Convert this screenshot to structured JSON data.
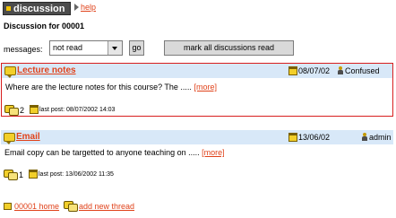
{
  "header": {
    "tab_label": "discussion",
    "help_label": "help"
  },
  "page_title": "Discussion for 00001",
  "filter": {
    "label": "messages:",
    "selected": "not read",
    "go_label": "go",
    "mark_all_label": "mark all discussions read"
  },
  "threads": [
    {
      "title": "Lecture notes",
      "date": "08/07/02",
      "user": "Confused",
      "excerpt": "Where are the lecture notes for this course? The .....",
      "more_label": "[more]",
      "count": "2",
      "last_post": "last post: 08/07/2002 14:03"
    },
    {
      "title": "Email",
      "date": "13/06/02",
      "user": "admin",
      "excerpt": "Email copy can be targetted to anyone teaching on .....",
      "more_label": "[more]",
      "count": "1",
      "last_post": "last post: 13/06/2002 11:35"
    }
  ],
  "footer": {
    "home_label": "00001 home",
    "new_thread_label": "add new thread"
  },
  "colors": {
    "accent": "#e0421a",
    "thread_head_bg": "#d8e8f8",
    "active_border": "#d81e1e"
  },
  "icons": [
    "speech-bubble-icon",
    "calendar-icon",
    "user-icon",
    "replies-icon",
    "home-icon",
    "new-thread-icon",
    "arrow-right-icon"
  ]
}
